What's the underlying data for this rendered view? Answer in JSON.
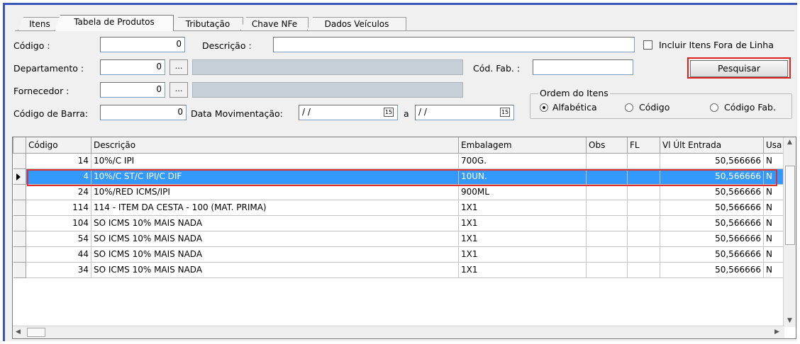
{
  "tabs": [
    {
      "label": "Itens",
      "active": false
    },
    {
      "label": "Tabela de Produtos",
      "active": true
    },
    {
      "label": "Tributação",
      "active": false
    },
    {
      "label": "Chave NFe",
      "active": false
    },
    {
      "label": "Dados Veículos",
      "active": false
    }
  ],
  "filters": {
    "codigo_label": "Código :",
    "codigo_value": "0",
    "descricao_label": "Descrição :",
    "descricao_value": "",
    "incluir_label": "Incluir Itens Fora de Linha",
    "departamento_label": "Departamento :",
    "departamento_value": "0",
    "fornecedor_label": "Fornecedor :",
    "fornecedor_value": "0",
    "cod_fab_label": "Cód. Fab. :",
    "cod_fab_value": "",
    "codigo_barra_label": "Código de Barra:",
    "codigo_barra_value": "0",
    "data_mov_label": "Data Movimentação:",
    "data_de": "/ /",
    "data_sep": "a",
    "data_ate": "/ /",
    "browse_label": "...",
    "calendar_glyph": "15"
  },
  "order": {
    "title": "Ordem do Itens",
    "options": [
      "Alfabética",
      "Código",
      "Código Fab."
    ],
    "selected": "Alfabética"
  },
  "search_button": "Pesquisar",
  "grid": {
    "columns": [
      "Código",
      "Descrição",
      "Embalagem",
      "Obs",
      "FL",
      "Vl Últ Entrada",
      "Usa"
    ],
    "rows": [
      {
        "codigo": "14",
        "descricao": "10%/C IPI",
        "embalagem": "700G.",
        "obs": "",
        "fl": "",
        "vl": "50,566666",
        "usa": "N"
      },
      {
        "codigo": "4",
        "descricao": "10%/C ST/C IPI/C DIF",
        "embalagem": "10UN.",
        "obs": "",
        "fl": "",
        "vl": "50,566666",
        "usa": "N"
      },
      {
        "codigo": "24",
        "descricao": "10%/RED ICMS/IPI",
        "embalagem": "900ML",
        "obs": "",
        "fl": "",
        "vl": "50,566666",
        "usa": "N"
      },
      {
        "codigo": "114",
        "descricao": "114 - ITEM DA CESTA - 100 (MAT. PRIMA)",
        "embalagem": "1X1",
        "obs": "",
        "fl": "",
        "vl": "50,566666",
        "usa": "N"
      },
      {
        "codigo": "104",
        "descricao": "SO ICMS 10% MAIS NADA",
        "embalagem": "1X1",
        "obs": "",
        "fl": "",
        "vl": "50,566666",
        "usa": "N"
      },
      {
        "codigo": "54",
        "descricao": "SO ICMS 10% MAIS NADA",
        "embalagem": "1X1",
        "obs": "",
        "fl": "",
        "vl": "50,566666",
        "usa": "N"
      },
      {
        "codigo": "44",
        "descricao": "SO ICMS 10% MAIS NADA",
        "embalagem": "1X1",
        "obs": "",
        "fl": "",
        "vl": "50,566666",
        "usa": "N"
      },
      {
        "codigo": "34",
        "descricao": "SO ICMS 10% MAIS NADA",
        "embalagem": "1X1",
        "obs": "",
        "fl": "",
        "vl": "50,566666",
        "usa": "N"
      }
    ],
    "selected_index": 1
  },
  "colors": {
    "selection": "#3399ff",
    "highlight_border": "#e02020",
    "window_border": "#3a56b8"
  }
}
